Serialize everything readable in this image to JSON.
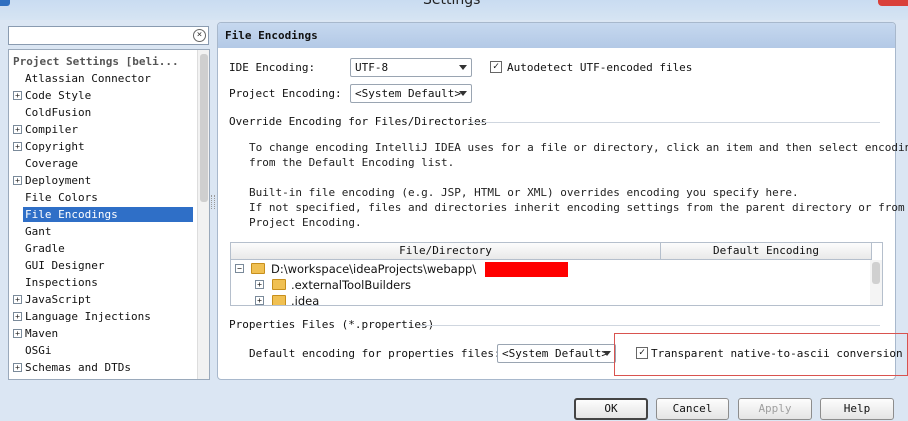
{
  "window": {
    "title": "Settings"
  },
  "search": {
    "value": "",
    "clear_icon": "×"
  },
  "sidebar": {
    "items": [
      {
        "label": "Project Settings [beli...",
        "expandable": false,
        "header": true
      },
      {
        "label": "Atlassian Connector",
        "expandable": false
      },
      {
        "label": "Code Style",
        "expandable": true
      },
      {
        "label": "ColdFusion",
        "expandable": false
      },
      {
        "label": "Compiler",
        "expandable": true
      },
      {
        "label": "Copyright",
        "expandable": true
      },
      {
        "label": "Coverage",
        "expandable": false
      },
      {
        "label": "Deployment",
        "expandable": true
      },
      {
        "label": "File Colors",
        "expandable": false
      },
      {
        "label": "File Encodings",
        "expandable": false,
        "selected": true
      },
      {
        "label": "Gant",
        "expandable": false
      },
      {
        "label": "Gradle",
        "expandable": false
      },
      {
        "label": "GUI Designer",
        "expandable": false
      },
      {
        "label": "Inspections",
        "expandable": false
      },
      {
        "label": "JavaScript",
        "expandable": true
      },
      {
        "label": "Language Injections",
        "expandable": true
      },
      {
        "label": "Maven",
        "expandable": true
      },
      {
        "label": "OSGi",
        "expandable": false
      },
      {
        "label": "Schemas and DTDs",
        "expandable": true
      }
    ],
    "expand_glyph": "+"
  },
  "panel": {
    "title": "File Encodings",
    "ide_encoding_label": "IDE Encoding:",
    "ide_encoding_value": "UTF-8",
    "autodetect_label": "Autodetect UTF-encoded files",
    "autodetect_checked": true,
    "project_encoding_label": "Project Encoding:",
    "project_encoding_value": "<System Default>",
    "override_section": "Override Encoding for Files/Directories",
    "desc1": "To change encoding IntelliJ IDEA uses for a file or directory, click an item and then select encoding",
    "desc2": "from the Default Encoding list.",
    "desc3": "Built-in file encoding (e.g. JSP, HTML or XML) overrides encoding you specify here.",
    "desc4": "If not specified, files and directories inherit encoding settings from the parent directory or from the",
    "desc5": "Project Encoding.",
    "table": {
      "columns": [
        "File/Directory",
        "Default Encoding"
      ],
      "rows": [
        {
          "path": "D:\\workspace\\ideaProjects\\webapp\\",
          "expand": "−"
        },
        {
          "path": ".externalToolBuilders",
          "expand": "+"
        },
        {
          "path": ".idea",
          "expand": "+"
        }
      ]
    },
    "properties_section": "Properties Files (*.properties)",
    "default_properties_label": "Default encoding for properties files:",
    "default_properties_value": "<System Default>",
    "transparent_label": "Transparent native-to-ascii conversion",
    "transparent_checked": true,
    "check_glyph": "✓"
  },
  "buttons": {
    "ok": "OK",
    "cancel": "Cancel",
    "apply": "Apply",
    "help": "Help"
  },
  "colors": {
    "selection": "#2f6fc7",
    "redaction": "#ff0000",
    "highlight": "#d9534f"
  }
}
